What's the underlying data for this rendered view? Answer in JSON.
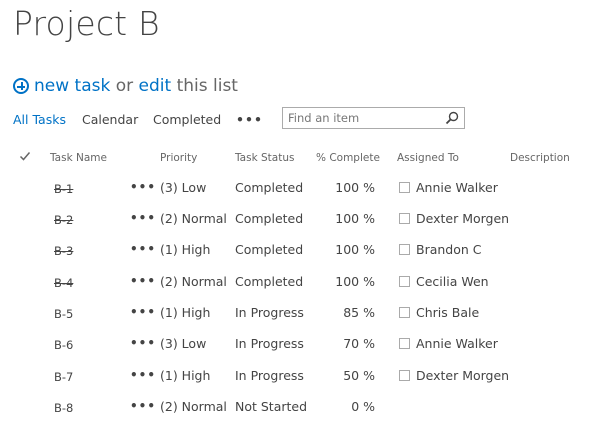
{
  "page": {
    "title": "Project B",
    "new_task_label": "new task",
    "or_label": "or",
    "edit_label": "edit",
    "this_list_label": "this list"
  },
  "views": {
    "all_tasks": "All Tasks",
    "calendar": "Calendar",
    "completed": "Completed",
    "more": "•••"
  },
  "search": {
    "placeholder": "Find an item",
    "icon": "search-icon"
  },
  "columns": {
    "task_name": "Task Name",
    "priority": "Priority",
    "task_status": "Task Status",
    "percent_complete": "% Complete",
    "assigned_to": "Assigned To",
    "description": "Description"
  },
  "rows": [
    {
      "name": "B-1",
      "priority": "(3) Low",
      "status": "Completed",
      "percent": "100 %",
      "assigned": "Annie Walker",
      "done": true
    },
    {
      "name": "B-2",
      "priority": "(2) Normal",
      "status": "Completed",
      "percent": "100 %",
      "assigned": "Dexter Morgen",
      "done": true
    },
    {
      "name": "B-3",
      "priority": "(1) High",
      "status": "Completed",
      "percent": "100 %",
      "assigned": "Brandon C",
      "done": true
    },
    {
      "name": "B-4",
      "priority": "(2) Normal",
      "status": "Completed",
      "percent": "100 %",
      "assigned": "Cecilia Wen",
      "done": true
    },
    {
      "name": "B-5",
      "priority": "(1) High",
      "status": "In Progress",
      "percent": "85 %",
      "assigned": "Chris Bale",
      "done": false
    },
    {
      "name": "B-6",
      "priority": "(3) Low",
      "status": "In Progress",
      "percent": "70 %",
      "assigned": "Annie Walker",
      "done": false
    },
    {
      "name": "B-7",
      "priority": "(1) High",
      "status": "In Progress",
      "percent": "50 %",
      "assigned": "Dexter Morgen",
      "done": false
    },
    {
      "name": "B-8",
      "priority": "(2) Normal",
      "status": "Not Started",
      "percent": "0 %",
      "assigned": "",
      "done": false
    }
  ],
  "row_menu": "•••",
  "colors": {
    "accent": "#0072c6",
    "text": "#444444",
    "muted": "#666666"
  }
}
